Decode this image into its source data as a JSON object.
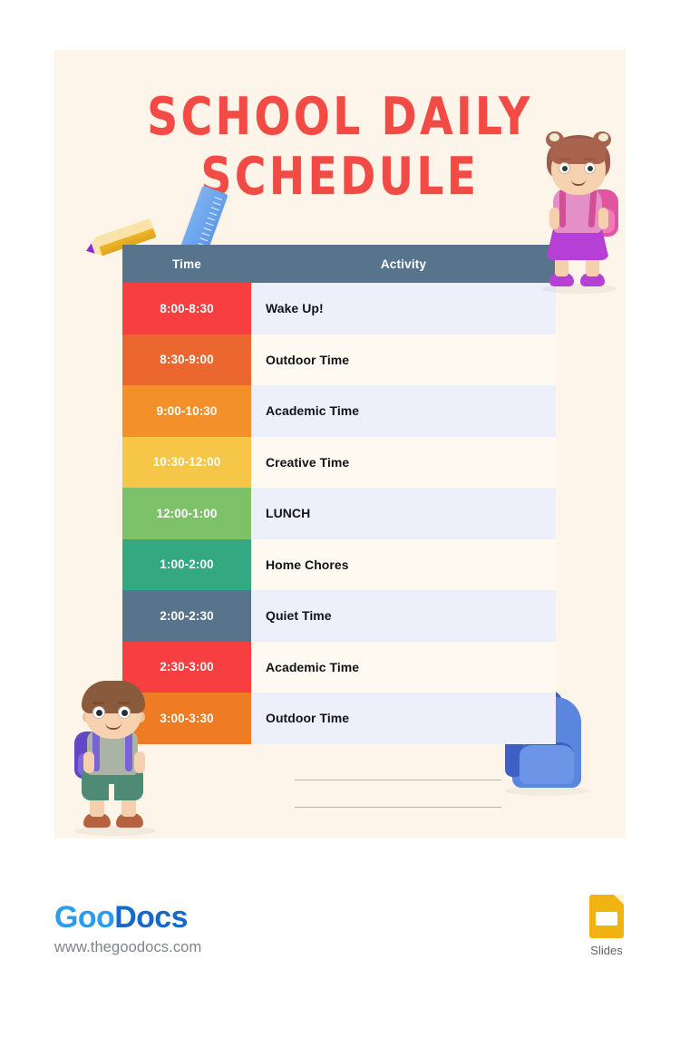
{
  "document": {
    "title_line_1": "SCHOOL DAILY",
    "title_line_2": "SCHEDULE",
    "title_color": "#F24A44",
    "card_background": "#FDF5E9",
    "page_background": "#FFFFFF"
  },
  "table": {
    "header_background": "#57748C",
    "columns": [
      "Time",
      "Activity"
    ],
    "row_bg_alt_a": "#EDF0FB",
    "row_bg_alt_b": "#FEFAF1",
    "rows": [
      {
        "time": "8:00-8:30",
        "activity": "Wake Up!",
        "color": "#F73E41"
      },
      {
        "time": "8:30-9:00",
        "activity": "Outdoor Time",
        "color": "#EC6630"
      },
      {
        "time": "9:00-10:30",
        "activity": "Academic Time",
        "color": "#F4902A"
      },
      {
        "time": "10:30-12:00",
        "activity": "Creative Time",
        "color": "#F5C647"
      },
      {
        "time": "12:00-1:00",
        "activity": "LUNCH",
        "color": "#7DC268"
      },
      {
        "time": "1:00-2:00",
        "activity": "Home Chores",
        "color": "#33A881"
      },
      {
        "time": "2:00-2:30",
        "activity": "Quiet Time",
        "color": "#57748C"
      },
      {
        "time": "2:30-3:00",
        "activity": "Academic Time",
        "color": "#F73E41"
      },
      {
        "time": "3:00-3:30",
        "activity": "Outdoor Time",
        "color": "#F07B25"
      }
    ]
  },
  "decorations": {
    "ruler": "ruler-icon",
    "pencil": "pencil-icon",
    "girl": "girl-student-illustration",
    "boy": "boy-student-illustration",
    "backpack": "backpack-illustration",
    "note_lines": 2
  },
  "footer": {
    "brand_part_1": "Goo",
    "brand_part_2": "Docs",
    "brand_url": "www.thegoodocs.com",
    "brand_color_light": "#2E9BEF",
    "brand_color_dark": "#1669C9",
    "slides_label": "Slides",
    "slides_color": "#F1B311"
  }
}
